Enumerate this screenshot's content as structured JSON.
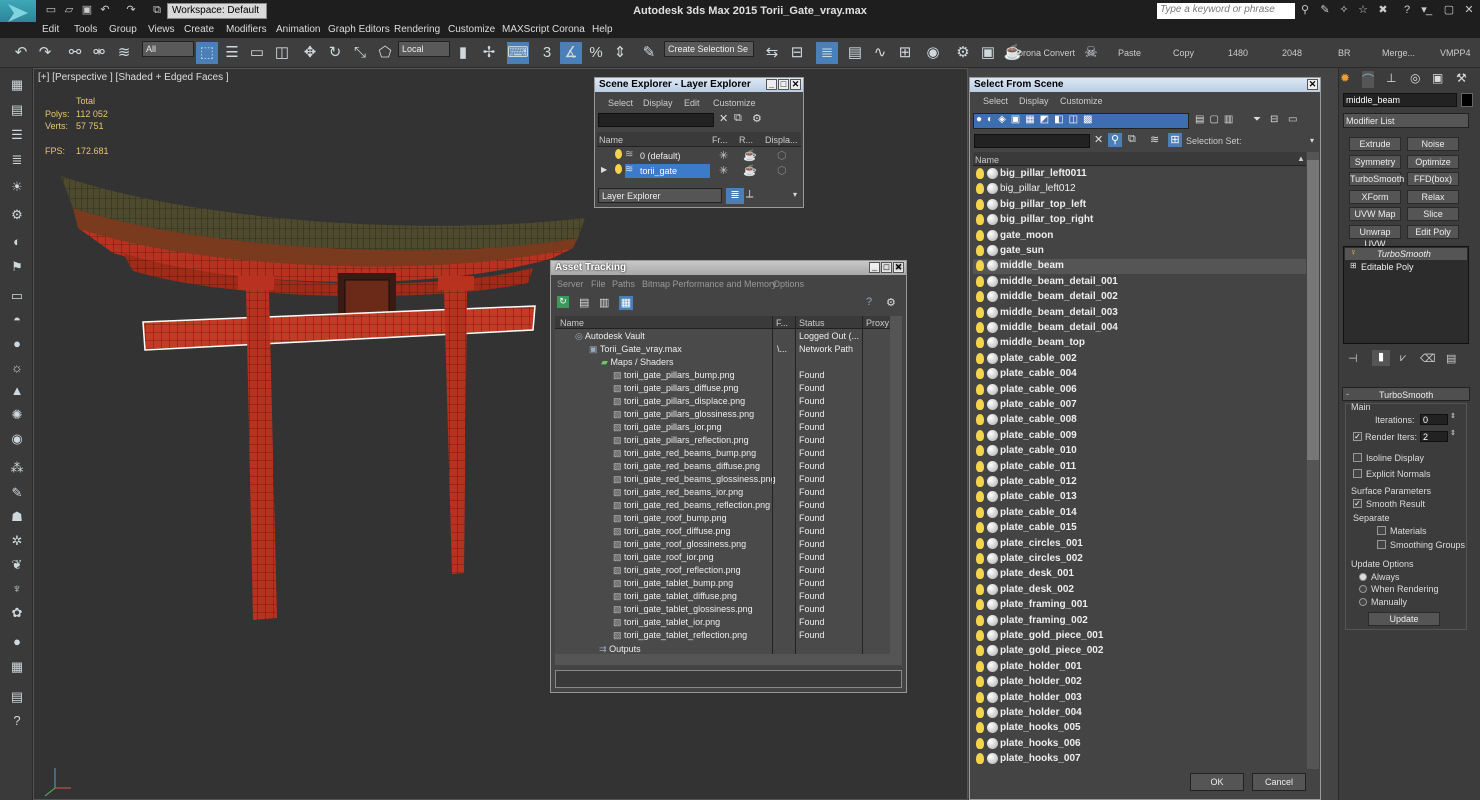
{
  "app": {
    "title": "Autodesk 3ds Max  2015    Torii_Gate_vray.max",
    "logo_label": "MAX",
    "workspace": "Workspace: Default",
    "search_placeholder": "Type a keyword or phrase"
  },
  "menu": [
    "Edit",
    "Tools",
    "Group",
    "Views",
    "Create",
    "Modifiers",
    "Animation",
    "Graph Editors",
    "Rendering",
    "Customize",
    "MAXScript",
    "Corona",
    "Help"
  ],
  "toolbar": {
    "filter": "All",
    "coord": "Local",
    "selection_set": "Create Selection Se",
    "corona_convert": "orona Convert",
    "paste": "Paste",
    "copy": "Copy",
    "w": "1480",
    "h": "2048",
    "br": "BR",
    "merge": "Merge...",
    "vmpp": "VMPP4"
  },
  "viewport": {
    "label": "[+] [Perspective ] [Shaded + Edged Faces ]",
    "total": "Total",
    "polys_label": "Polys:",
    "polys": "112 052",
    "verts_label": "Verts:",
    "verts": "57 751",
    "fps_label": "FPS:",
    "fps": "172.681"
  },
  "scene_explorer": {
    "title": "Scene Explorer - Layer Explorer",
    "menu": [
      "Select",
      "Display",
      "Edit",
      "Customize"
    ],
    "cols": [
      "Name",
      "Fr...",
      "R...",
      "Displa..."
    ],
    "rows": [
      "0 (default)",
      "torii_gate"
    ],
    "footer": "Layer Explorer"
  },
  "asset_tracking": {
    "title": "Asset Tracking",
    "menu": [
      "Server",
      "File",
      "Paths",
      "Bitmap Performance and Memory",
      "Options"
    ],
    "cols": [
      "Name",
      "F...",
      "Status",
      "Proxy"
    ],
    "vault": {
      "name": "Autodesk Vault",
      "status": "Logged Out (..."
    },
    "file": {
      "name": "Torii_Gate_vray.max",
      "path": "\\...",
      "status": "Network Path"
    },
    "maps_folder": "Maps / Shaders",
    "maps": [
      "torii_gate_pillars_bump.png",
      "torii_gate_pillars_diffuse.png",
      "torii_gate_pillars_displace.png",
      "torii_gate_pillars_glossiness.png",
      "torii_gate_pillars_ior.png",
      "torii_gate_pillars_reflection.png",
      "torii_gate_red_beams_bump.png",
      "torii_gate_red_beams_diffuse.png",
      "torii_gate_red_beams_glossiness.png",
      "torii_gate_red_beams_ior.png",
      "torii_gate_red_beams_reflection.png",
      "torii_gate_roof_bump.png",
      "torii_gate_roof_diffuse.png",
      "torii_gate_roof_glossiness.png",
      "torii_gate_roof_ior.png",
      "torii_gate_roof_reflection.png",
      "torii_gate_tablet_bump.png",
      "torii_gate_tablet_diffuse.png",
      "torii_gate_tablet_glossiness.png",
      "torii_gate_tablet_ior.png",
      "torii_gate_tablet_reflection.png"
    ],
    "map_status": "Found",
    "outputs": "Outputs"
  },
  "select_from_scene": {
    "title": "Select From Scene",
    "menu": [
      "Select",
      "Display",
      "Customize"
    ],
    "selection_set_label": "Selection Set:",
    "col_name": "Name",
    "objects": [
      {
        "name": "big_pillar_left0011",
        "bold": true
      },
      {
        "name": "big_pillar_left012",
        "bold": false
      },
      {
        "name": "big_pillar_top_left",
        "bold": true
      },
      {
        "name": "big_pillar_top_right",
        "bold": true
      },
      {
        "name": "gate_moon",
        "bold": true
      },
      {
        "name": "gate_sun",
        "bold": true
      },
      {
        "name": "middle_beam",
        "bold": true,
        "selected": true
      },
      {
        "name": "middle_beam_detail_001",
        "bold": true
      },
      {
        "name": "middle_beam_detail_002",
        "bold": true
      },
      {
        "name": "middle_beam_detail_003",
        "bold": true
      },
      {
        "name": "middle_beam_detail_004",
        "bold": true
      },
      {
        "name": "middle_beam_top",
        "bold": true
      },
      {
        "name": "plate_cable_002",
        "bold": true
      },
      {
        "name": "plate_cable_004",
        "bold": true
      },
      {
        "name": "plate_cable_006",
        "bold": true
      },
      {
        "name": "plate_cable_007",
        "bold": true
      },
      {
        "name": "plate_cable_008",
        "bold": true
      },
      {
        "name": "plate_cable_009",
        "bold": true
      },
      {
        "name": "plate_cable_010",
        "bold": true
      },
      {
        "name": "plate_cable_011",
        "bold": true
      },
      {
        "name": "plate_cable_012",
        "bold": true
      },
      {
        "name": "plate_cable_013",
        "bold": true
      },
      {
        "name": "plate_cable_014",
        "bold": true
      },
      {
        "name": "plate_cable_015",
        "bold": true
      },
      {
        "name": "plate_circles_001",
        "bold": true
      },
      {
        "name": "plate_circles_002",
        "bold": true
      },
      {
        "name": "plate_desk_001",
        "bold": true
      },
      {
        "name": "plate_desk_002",
        "bold": true
      },
      {
        "name": "plate_framing_001",
        "bold": true
      },
      {
        "name": "plate_framing_002",
        "bold": true
      },
      {
        "name": "plate_gold_piece_001",
        "bold": true
      },
      {
        "name": "plate_gold_piece_002",
        "bold": true
      },
      {
        "name": "plate_holder_001",
        "bold": true
      },
      {
        "name": "plate_holder_002",
        "bold": true
      },
      {
        "name": "plate_holder_003",
        "bold": true
      },
      {
        "name": "plate_holder_004",
        "bold": true
      },
      {
        "name": "plate_hooks_005",
        "bold": true
      },
      {
        "name": "plate_hooks_006",
        "bold": true
      },
      {
        "name": "plate_hooks_007",
        "bold": true
      }
    ],
    "ok": "OK",
    "cancel": "Cancel"
  },
  "command_panel": {
    "object_name": "middle_beam",
    "modifier_list": "Modifier List",
    "buttons": [
      "Extrude",
      "Noise",
      "Symmetry",
      "Optimize",
      "TurboSmooth",
      "FFD(box)",
      "XForm",
      "Relax",
      "UVW Map",
      "Slice",
      "Unwrap UVW",
      "Edit Poly"
    ],
    "stack": [
      "TurboSmooth",
      "Editable Poly"
    ],
    "rollout_title": "TurboSmooth",
    "main": "Main",
    "iterations_label": "Iterations:",
    "iterations": "0",
    "render_iters_label": "Render Iters:",
    "render_iters": "2",
    "isoline": "Isoline Display",
    "explicit_normals": "Explicit Normals",
    "surface_params": "Surface Parameters",
    "smooth_result": "Smooth Result",
    "separate": "Separate",
    "materials": "Materials",
    "smoothing_groups": "Smoothing Groups",
    "update_options": "Update Options",
    "always": "Always",
    "when_rendering": "When Rendering",
    "manually": "Manually",
    "update": "Update"
  },
  "colors": {
    "torii_red": "#b8321f",
    "roof_dark": "#5a4a32",
    "select_highlight": "#3d7ac9",
    "found_bg": "#4a4a4a"
  }
}
